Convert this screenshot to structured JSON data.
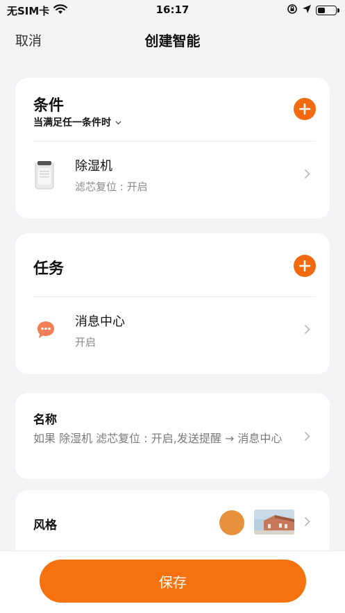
{
  "status_bar": {
    "carrier": "无SIM卡",
    "time": "16:17",
    "battery_level": 0.45
  },
  "nav": {
    "cancel": "取消",
    "title": "创建智能"
  },
  "conditions": {
    "title": "条件",
    "mode": "当满足任一条件时",
    "items": [
      {
        "title": "除湿机",
        "desc": "滤芯复位 : 开启",
        "icon": "dehumidifier-icon"
      }
    ]
  },
  "tasks": {
    "title": "任务",
    "items": [
      {
        "title": "消息中心",
        "desc": "开启",
        "icon": "message-bubble-icon"
      }
    ]
  },
  "name": {
    "label": "名称",
    "value": "如果 除湿机 滤芯复位 : 开启,发送提醒 → 消息中心"
  },
  "style": {
    "label": "风格",
    "color": "#e8913c"
  },
  "footer": {
    "save": "保存"
  },
  "colors": {
    "accent": "#f26a10",
    "background": "#f3f3f5",
    "card": "#ffffff"
  }
}
